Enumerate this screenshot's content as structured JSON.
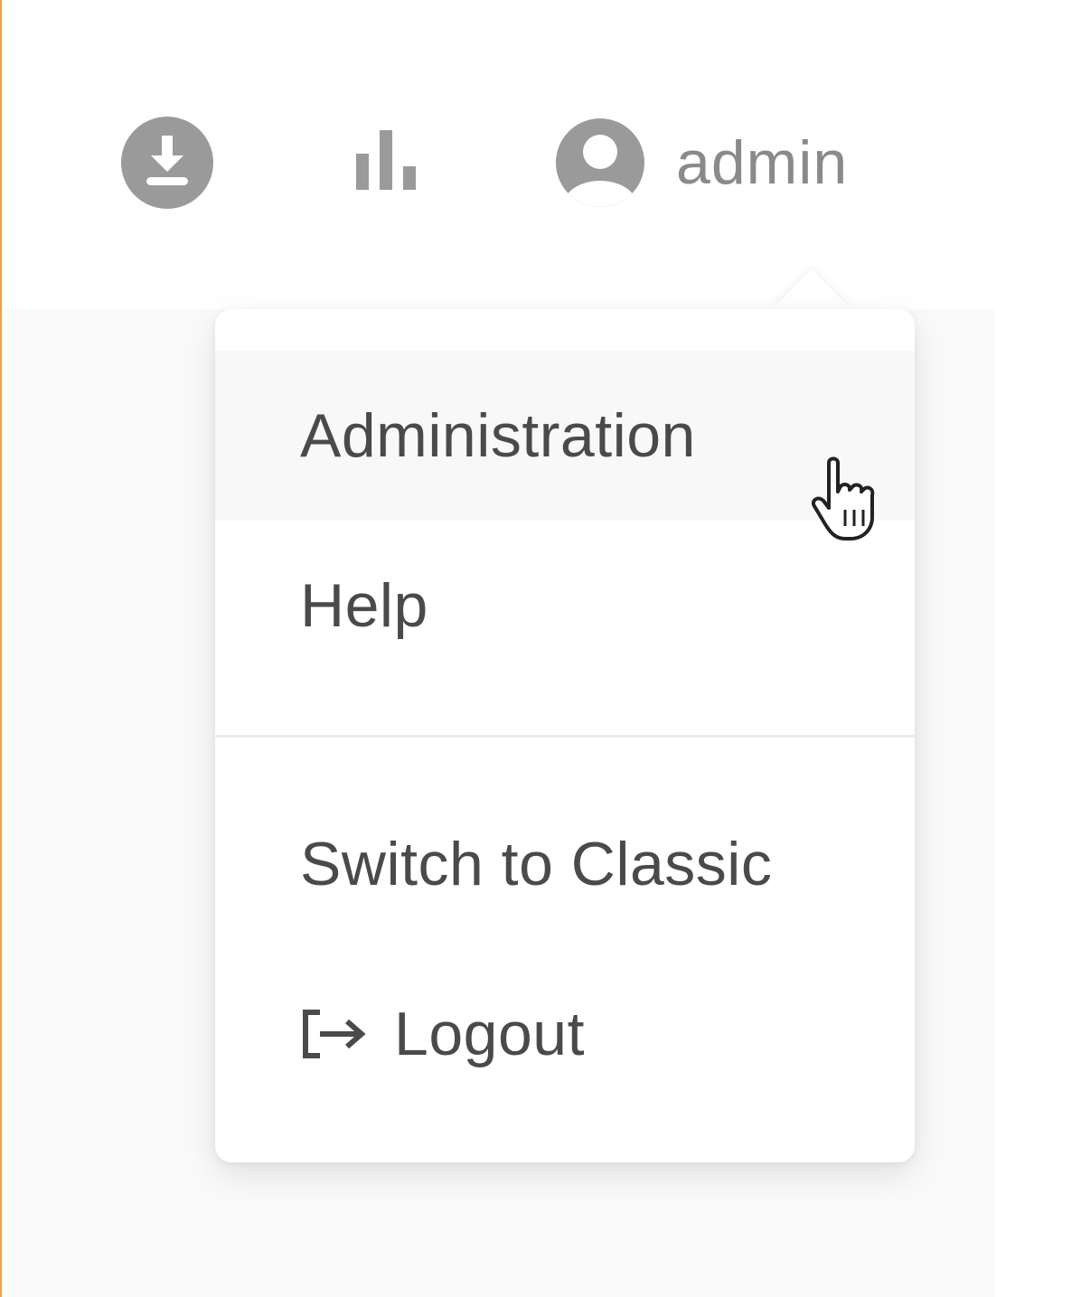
{
  "header": {
    "icons": {
      "download": "download-icon",
      "stats": "bar-chart-icon",
      "user": "account-circle-icon"
    },
    "user_name": "admin"
  },
  "user_menu": {
    "items": [
      {
        "label": "Administration",
        "hovered": true
      },
      {
        "label": "Help"
      },
      {
        "label": "Switch to Classic"
      },
      {
        "label": "Logout",
        "icon": "logout-icon"
      }
    ]
  },
  "colors": {
    "icon_gray": "#9a9a9a",
    "text": "#4a4a4a",
    "accent_border": "#f0a050"
  }
}
